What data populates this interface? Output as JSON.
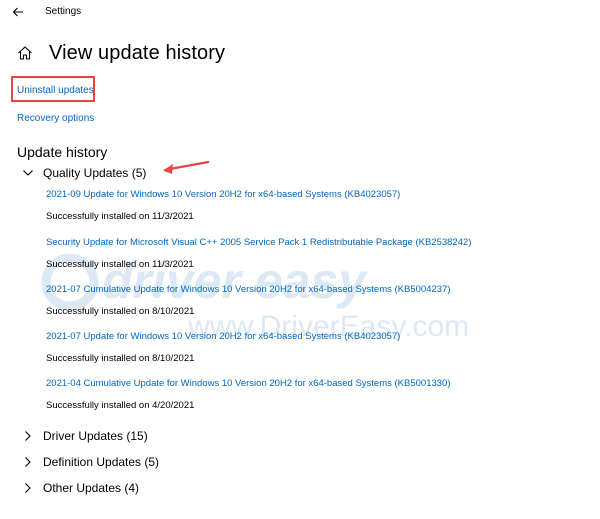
{
  "window": {
    "title": "Settings"
  },
  "page": {
    "title": "View update history"
  },
  "links": {
    "uninstall": "Uninstall updates",
    "recovery": "Recovery options"
  },
  "history": {
    "title": "Update history",
    "quality": {
      "label": "Quality Updates (5)",
      "items": [
        {
          "name": "2021-09 Update for Windows 10 Version 20H2 for x64-based Systems (KB4023057)",
          "status": "Successfully installed on 11/3/2021"
        },
        {
          "name": "Security Update for Microsoft Visual C++ 2005 Service Pack 1 Redistributable Package (KB2538242)",
          "status": "Successfully installed on 11/3/2021"
        },
        {
          "name": "2021-07 Cumulative Update for Windows 10 Version 20H2 for x64-based Systems (KB5004237)",
          "status": "Successfully installed on 8/10/2021"
        },
        {
          "name": "2021-07 Update for Windows 10 Version 20H2 for x64-based Systems (KB4023057)",
          "status": "Successfully installed on 8/10/2021"
        },
        {
          "name": "2021-04 Cumulative Update for Windows 10 Version 20H2 for x64-based Systems (KB5001330)",
          "status": "Successfully installed on 4/20/2021"
        }
      ]
    },
    "driver": {
      "label": "Driver Updates (15)"
    },
    "definition": {
      "label": "Definition Updates (5)"
    },
    "other": {
      "label": "Other Updates (4)"
    }
  },
  "watermark": {
    "line1": "driver easy",
    "line2": "www.DriverEasy.com"
  },
  "colors": {
    "link": "#0067c0",
    "highlight": "#e64545",
    "watermark": "#dce9f5"
  }
}
